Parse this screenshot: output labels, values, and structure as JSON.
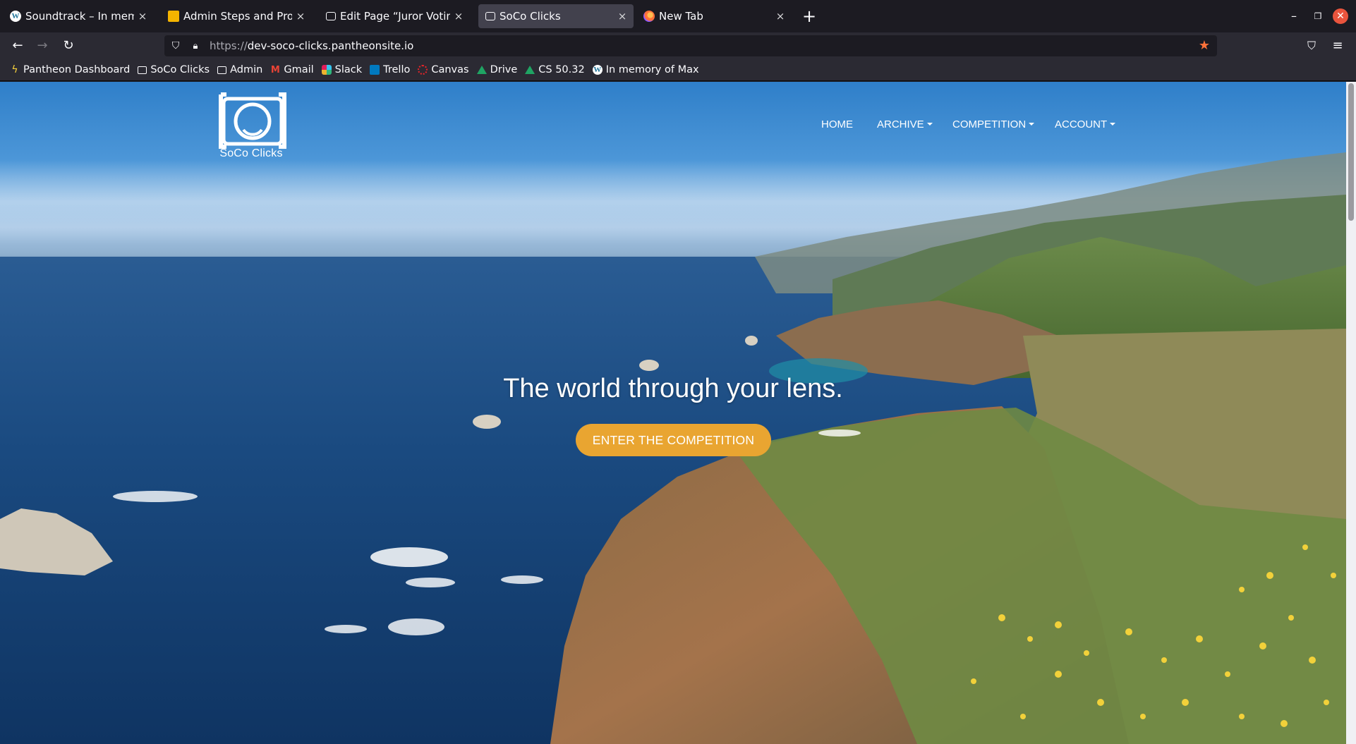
{
  "browser": {
    "tabs": [
      {
        "title": "Soundtrack – In memory o",
        "favicon": "wordpress-icon",
        "active": false
      },
      {
        "title": "Admin Steps and Procedu",
        "favicon": "slides-icon",
        "active": false
      },
      {
        "title": "Edit Page “Juror Voting” ‹",
        "favicon": "camera-icon",
        "active": false
      },
      {
        "title": "SoCo Clicks",
        "favicon": "camera-icon",
        "active": true
      },
      {
        "title": "New Tab",
        "favicon": "firefox-icon",
        "active": false
      }
    ],
    "new_tab_glyph": "+",
    "url": {
      "protocol": "https://",
      "host": "dev-soco-clicks.pantheonsite.io"
    },
    "bookmarks": [
      {
        "label": "Pantheon Dashboard",
        "icon": "pantheon-icon"
      },
      {
        "label": "SoCo Clicks",
        "icon": "camera-icon"
      },
      {
        "label": "Admin",
        "icon": "camera-icon"
      },
      {
        "label": "Gmail",
        "icon": "gmail-icon"
      },
      {
        "label": "Slack",
        "icon": "slack-icon"
      },
      {
        "label": "Trello",
        "icon": "trello-icon"
      },
      {
        "label": "Canvas",
        "icon": "canvas-icon"
      },
      {
        "label": "Drive",
        "icon": "drive-icon"
      },
      {
        "label": "CS 50.32",
        "icon": "drive-icon"
      },
      {
        "label": "In memory of Max",
        "icon": "wordpress-icon"
      }
    ]
  },
  "site": {
    "logo_text": "SoCo Clicks",
    "nav": {
      "home": "HOME",
      "archive": "ARCHIVE",
      "competition": "COMPETITION",
      "account": "ACCOUNT"
    },
    "tagline": "The world through your lens.",
    "cta": "ENTER THE COMPETITION"
  },
  "colors": {
    "cta": "#e9a531",
    "bookmark_star": "#ff7139",
    "window_close": "#e9543d"
  }
}
